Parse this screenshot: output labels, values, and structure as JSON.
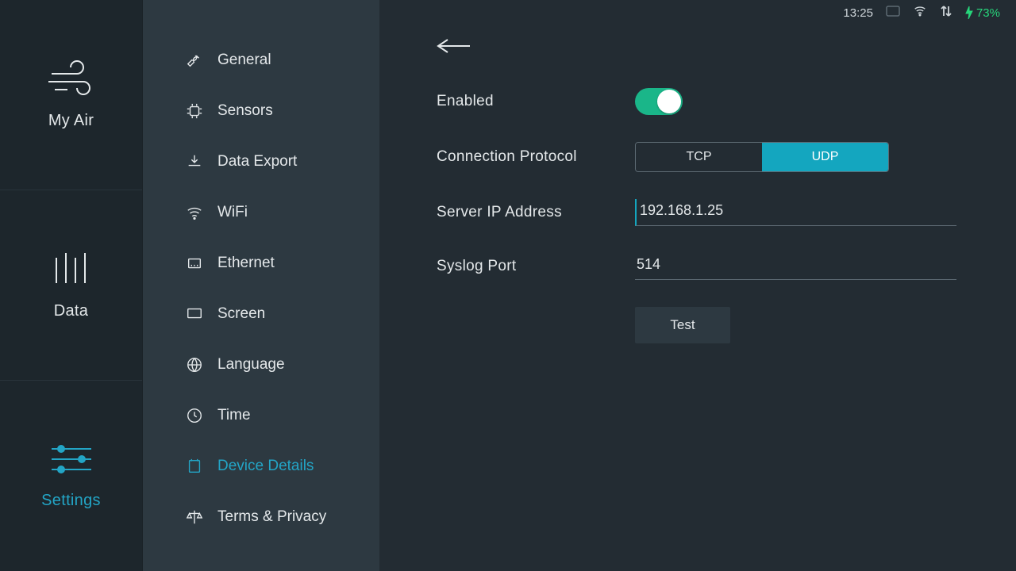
{
  "status": {
    "time": "13:25",
    "battery_text": "73%"
  },
  "main_nav": {
    "my_air": "My Air",
    "data": "Data",
    "settings": "Settings"
  },
  "settings_nav": {
    "general": "General",
    "sensors": "Sensors",
    "data_export": "Data Export",
    "wifi": "WiFi",
    "ethernet": "Ethernet",
    "screen": "Screen",
    "language": "Language",
    "time": "Time",
    "device_details": "Device Details",
    "terms": "Terms & Privacy"
  },
  "panel": {
    "enabled_label": "Enabled",
    "protocol_label": "Connection Protocol",
    "protocol_tcp": "TCP",
    "protocol_udp": "UDP",
    "ip_label": "Server IP Address",
    "ip_value": "192.168.1.25",
    "port_label": "Syslog Port",
    "port_value": "514",
    "test_label": "Test"
  }
}
